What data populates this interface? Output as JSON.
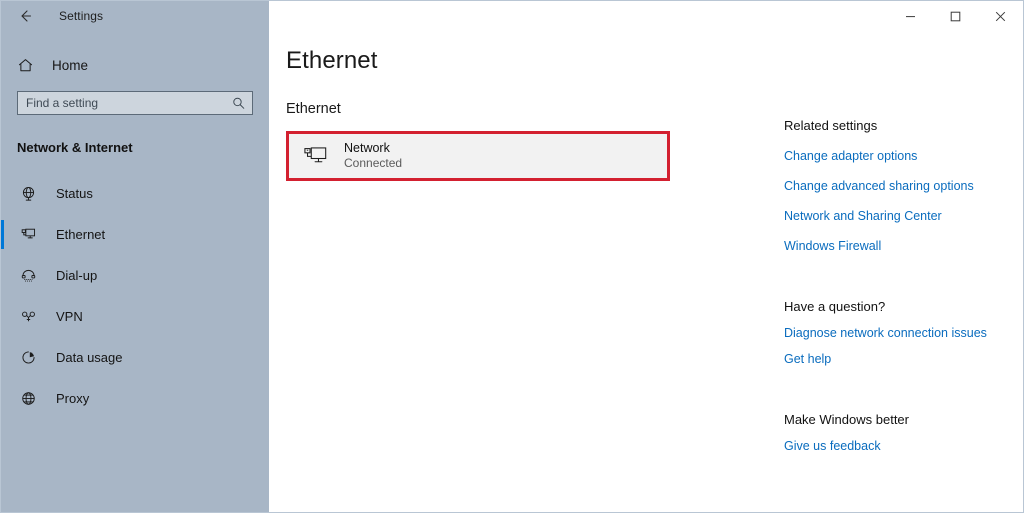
{
  "window": {
    "title": "Settings",
    "back_icon": "back-arrow-icon",
    "controls": {
      "minimize": "−",
      "maximize": "□",
      "close": "✕"
    }
  },
  "sidebar": {
    "home": {
      "label": "Home",
      "icon": "home-icon"
    },
    "search": {
      "placeholder": "Find a setting",
      "value": "",
      "icon": "search-icon"
    },
    "category": "Network & Internet",
    "items": [
      {
        "label": "Status",
        "icon": "network-status-icon",
        "selected": false
      },
      {
        "label": "Ethernet",
        "icon": "ethernet-icon",
        "selected": true
      },
      {
        "label": "Dial-up",
        "icon": "dialup-phone-icon",
        "selected": false
      },
      {
        "label": "VPN",
        "icon": "vpn-key-icon",
        "selected": false
      },
      {
        "label": "Data usage",
        "icon": "pie-chart-icon",
        "selected": false
      },
      {
        "label": "Proxy",
        "icon": "globe-icon",
        "selected": false
      }
    ]
  },
  "main": {
    "page_title": "Ethernet",
    "section_heading": "Ethernet",
    "network_card": {
      "name": "Network",
      "status": "Connected",
      "icon": "network-computer-icon",
      "highlighted": true,
      "highlight_color": "#d32030"
    }
  },
  "rail": {
    "related_heading": "Related settings",
    "related_links": [
      "Change adapter options",
      "Change advanced sharing options",
      "Network and Sharing Center",
      "Windows Firewall"
    ],
    "question_heading": "Have a question?",
    "question_links": [
      "Diagnose network connection issues",
      "Get help"
    ],
    "feedback_heading": "Make Windows better",
    "feedback_links": [
      "Give us feedback"
    ]
  },
  "colors": {
    "sidebar_bg": "#a8b6c6",
    "accent": "#0078d7",
    "link": "#0a6cbe",
    "highlight": "#d32030",
    "card_bg": "#f2f2f2"
  }
}
